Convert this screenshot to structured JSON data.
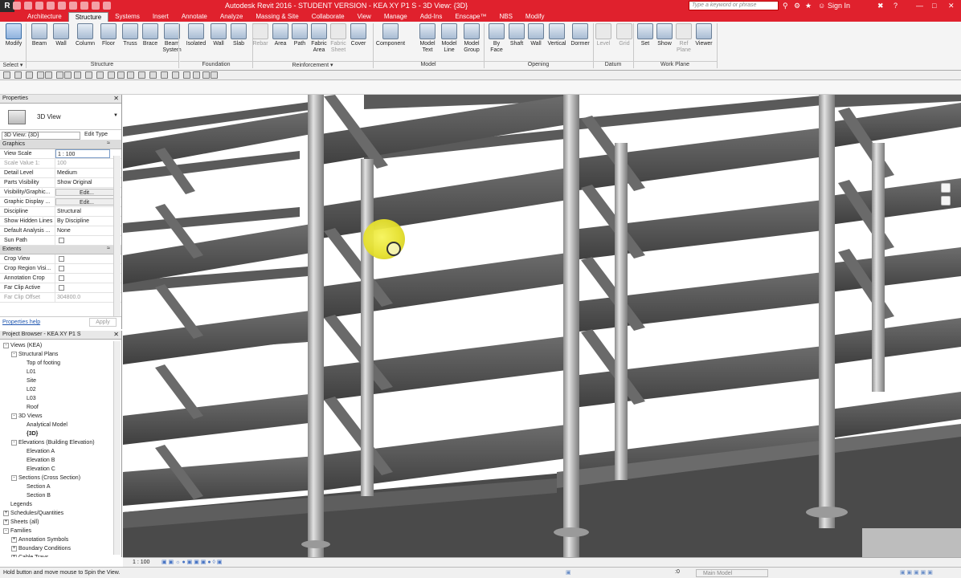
{
  "window": {
    "title": "Autodesk Revit 2016 - STUDENT VERSION -    KEA XY P1 S - 3D View: {3D}",
    "search_placeholder": "Type a keyword or phrase",
    "sign_in": "Sign In"
  },
  "tabs": [
    "Architecture",
    "Structure",
    "Systems",
    "Insert",
    "Annotate",
    "Analyze",
    "Massing & Site",
    "Collaborate",
    "View",
    "Manage",
    "Add-Ins",
    "Enscape™",
    "NBS",
    "Modify"
  ],
  "active_tab": "Structure",
  "ribbon": {
    "buttons": [
      {
        "label": "Modify",
        "state": "active"
      },
      {
        "label": "Beam"
      },
      {
        "label": "Wall"
      },
      {
        "label": "Column"
      },
      {
        "label": "Floor"
      },
      {
        "label": "Truss"
      },
      {
        "label": "Brace"
      },
      {
        "label": "Beam\nSystem"
      },
      {
        "label": "Isolated"
      },
      {
        "label": "Wall"
      },
      {
        "label": "Slab"
      },
      {
        "label": "Rebar",
        "state": "disabled"
      },
      {
        "label": "Area"
      },
      {
        "label": "Path"
      },
      {
        "label": "Fabric\nArea"
      },
      {
        "label": "Fabric\nSheet",
        "state": "disabled"
      },
      {
        "label": "Cover"
      },
      {
        "label": "Component"
      },
      {
        "label": "Model\nText"
      },
      {
        "label": "Model\nLine"
      },
      {
        "label": "Model\nGroup"
      },
      {
        "label": "By\nFace"
      },
      {
        "label": "Shaft"
      },
      {
        "label": "Wall"
      },
      {
        "label": "Vertical"
      },
      {
        "label": "Dormer"
      },
      {
        "label": "Level",
        "state": "disabled"
      },
      {
        "label": "Grid",
        "state": "disabled"
      },
      {
        "label": "Set"
      },
      {
        "label": "Show"
      },
      {
        "label": "Ref\nPlane",
        "state": "disabled"
      },
      {
        "label": "Viewer"
      }
    ],
    "panels": [
      "Select ▾",
      "Structure",
      "Foundation",
      "Reinforcement ▾",
      "Model",
      "Opening",
      "Datum",
      "Work Plane"
    ]
  },
  "properties": {
    "header": "Properties",
    "type_name": "3D View",
    "instance_selector": "3D View: {3D}",
    "edit_type": "Edit Type",
    "groups": [
      {
        "name": "Graphics",
        "rows": [
          {
            "key": "View Scale",
            "value": "1 : 100",
            "kind": "input"
          },
          {
            "key": "Scale Value   1:",
            "value": "100",
            "kind": "gray"
          },
          {
            "key": "Detail Level",
            "value": "Medium"
          },
          {
            "key": "Parts Visibility",
            "value": "Show Original"
          },
          {
            "key": "Visibility/Graphic...",
            "value": "Edit...",
            "kind": "button"
          },
          {
            "key": "Graphic Display ...",
            "value": "Edit...",
            "kind": "button"
          },
          {
            "key": "Discipline",
            "value": "Structural"
          },
          {
            "key": "Show Hidden Lines",
            "value": "By Discipline"
          },
          {
            "key": "Default Analysis ...",
            "value": "None"
          },
          {
            "key": "Sun Path",
            "value": "",
            "kind": "check"
          }
        ]
      },
      {
        "name": "Extents",
        "rows": [
          {
            "key": "Crop View",
            "value": "",
            "kind": "check"
          },
          {
            "key": "Crop Region Visi...",
            "value": "",
            "kind": "check"
          },
          {
            "key": "Annotation Crop",
            "value": "",
            "kind": "check"
          },
          {
            "key": "Far Clip Active",
            "value": "",
            "kind": "check"
          },
          {
            "key": "Far Clip Offset",
            "value": "304800.0",
            "kind": "gray"
          }
        ]
      }
    ],
    "help_link": "Properties help",
    "apply": "Apply"
  },
  "browser": {
    "header": "Project Browser - KEA XY P1 S",
    "nodes": [
      {
        "label": "Views (KEA)",
        "level": 0,
        "exp": "-"
      },
      {
        "label": "Structural Plans",
        "level": 1,
        "exp": "-"
      },
      {
        "label": "Top of footing",
        "level": 2
      },
      {
        "label": "L01",
        "level": 2
      },
      {
        "label": "Site",
        "level": 2
      },
      {
        "label": "L02",
        "level": 2
      },
      {
        "label": "L03",
        "level": 2
      },
      {
        "label": "Roof",
        "level": 2
      },
      {
        "label": "3D Views",
        "level": 1,
        "exp": "-"
      },
      {
        "label": "Analytical Model",
        "level": 2
      },
      {
        "label": "{3D}",
        "level": 2,
        "bold": true
      },
      {
        "label": "Elevations (Building Elevation)",
        "level": 1,
        "exp": "-"
      },
      {
        "label": "Elevation A",
        "level": 2
      },
      {
        "label": "Elevation B",
        "level": 2
      },
      {
        "label": "Elevation C",
        "level": 2
      },
      {
        "label": "Sections (Cross Section)",
        "level": 1,
        "exp": "-"
      },
      {
        "label": "Section A",
        "level": 2
      },
      {
        "label": "Section B",
        "level": 2
      },
      {
        "label": "Legends",
        "level": 0
      },
      {
        "label": "Schedules/Quantities",
        "level": 0,
        "exp": "+"
      },
      {
        "label": "Sheets (all)",
        "level": 0,
        "exp": "+"
      },
      {
        "label": "Families",
        "level": 0,
        "exp": "-"
      },
      {
        "label": "Annotation Symbols",
        "level": 1,
        "exp": "+"
      },
      {
        "label": "Boundary Conditions",
        "level": 1,
        "exp": "+"
      },
      {
        "label": "Cable Trays",
        "level": 1,
        "exp": "+"
      }
    ]
  },
  "view_control_bar": {
    "scale": "1 : 100"
  },
  "status": {
    "message": "Hold button and move mouse to Spin the View.",
    "model": "Main Model",
    "counter": ":0"
  },
  "colors": {
    "accent": "#e0212d",
    "beam": "#555555",
    "column": "#bdbdbd",
    "highlight": "#e9e42e"
  }
}
